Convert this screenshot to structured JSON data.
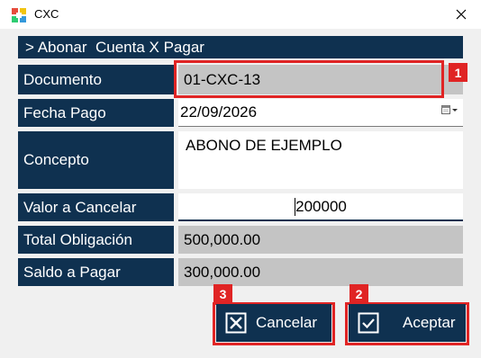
{
  "window": {
    "title": "CXC"
  },
  "form": {
    "header": "> Abonar  Cuenta X Pagar",
    "rows": {
      "documento": {
        "label": "Documento",
        "value": "01-CXC-13"
      },
      "fecha_pago": {
        "label": "Fecha Pago",
        "value": "22/09/2026"
      },
      "concepto": {
        "label": "Concepto",
        "value": "ABONO DE EJEMPLO"
      },
      "valor_cancelar": {
        "label": "Valor a Cancelar",
        "value": "200000"
      },
      "total_obligacion": {
        "label": "Total Obligación",
        "value": "500,000.00"
      },
      "saldo_pagar": {
        "label": "Saldo a Pagar",
        "value": "300,000.00"
      }
    }
  },
  "buttons": {
    "cancel_label": "Cancelar",
    "accept_label": "Aceptar"
  },
  "annotations": {
    "badge_1": "1",
    "badge_2": "2",
    "badge_3": "3"
  },
  "colors": {
    "navy": "#0f3150",
    "highlight": "#e02424",
    "readonly_gray": "#c4c4c4"
  },
  "icons": {
    "app": "app-logo-icon",
    "close": "close-icon",
    "calendar": "calendar-dropdown-icon",
    "cancel": "x-box-icon",
    "accept": "check-box-icon"
  }
}
